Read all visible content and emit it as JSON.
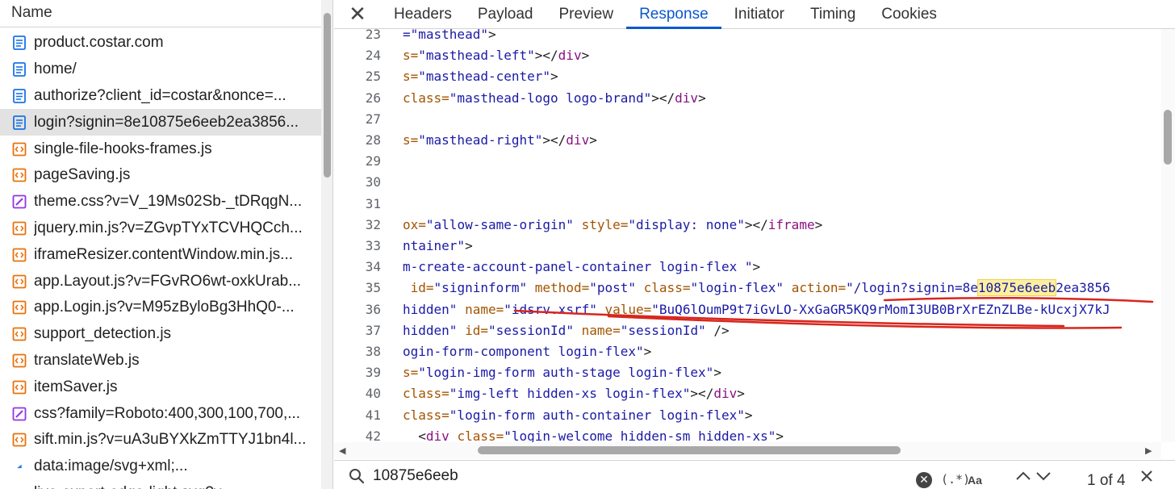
{
  "request_list": {
    "header": "Name",
    "items": [
      {
        "name": "product.costar.com",
        "icon": "document-icon"
      },
      {
        "name": "home/",
        "icon": "document-icon"
      },
      {
        "name": "authorize?client_id=costar&nonce=...",
        "icon": "document-icon"
      },
      {
        "name": "login?signin=8e10875e6eeb2ea3856...",
        "icon": "document-icon",
        "selected": true
      },
      {
        "name": "single-file-hooks-frames.js",
        "icon": "script-icon"
      },
      {
        "name": "pageSaving.js",
        "icon": "script-icon"
      },
      {
        "name": "theme.css?v=V_19Ms02Sb-_tDRqgN...",
        "icon": "stylesheet-icon"
      },
      {
        "name": "jquery.min.js?v=ZGvpTYxTCVHQCch...",
        "icon": "script-icon"
      },
      {
        "name": "iframeResizer.contentWindow.min.js...",
        "icon": "script-icon"
      },
      {
        "name": "app.Layout.js?v=FGvRO6wt-oxkUrab...",
        "icon": "script-icon"
      },
      {
        "name": "app.Login.js?v=M95zByloBg3HhQ0-...",
        "icon": "script-icon"
      },
      {
        "name": "support_detection.js",
        "icon": "script-icon"
      },
      {
        "name": "translateWeb.js",
        "icon": "script-icon"
      },
      {
        "name": "itemSaver.js",
        "icon": "script-icon"
      },
      {
        "name": "css?family=Roboto:400,300,100,700,...",
        "icon": "stylesheet-icon"
      },
      {
        "name": "sift.min.js?v=uA3uBYXkZmTTYJ1bn4l...",
        "icon": "script-icon"
      },
      {
        "name": "data:image/svg+xml;...",
        "icon": "image-icon"
      },
      {
        "name": "live-expert-edge-light.svg?v=...",
        "icon": "image-icon"
      }
    ]
  },
  "tabs": {
    "close": "✕",
    "items": [
      "Headers",
      "Payload",
      "Preview",
      "Response",
      "Initiator",
      "Timing",
      "Cookies"
    ],
    "active": "Response"
  },
  "response": {
    "lines": [
      {
        "n": "23",
        "parts": [
          [
            "val",
            "=\"masthead\""
          ],
          [
            "pun",
            ">"
          ]
        ]
      },
      {
        "n": "24",
        "parts": [
          [
            "att",
            "s="
          ],
          [
            "val",
            "\"masthead-left\""
          ],
          [
            "pun",
            "></"
          ],
          [
            "tag",
            "div"
          ],
          [
            "pun",
            ">"
          ]
        ]
      },
      {
        "n": "25",
        "parts": [
          [
            "att",
            "s="
          ],
          [
            "val",
            "\"masthead-center\""
          ],
          [
            "pun",
            ">"
          ]
        ]
      },
      {
        "n": "26",
        "parts": [
          [
            "att",
            "class="
          ],
          [
            "val",
            "\"masthead-logo logo-brand\""
          ],
          [
            "pun",
            "></"
          ],
          [
            "tag",
            "div"
          ],
          [
            "pun",
            ">"
          ]
        ]
      },
      {
        "n": "27",
        "parts": []
      },
      {
        "n": "28",
        "parts": [
          [
            "att",
            "s="
          ],
          [
            "val",
            "\"masthead-right\""
          ],
          [
            "pun",
            "></"
          ],
          [
            "tag",
            "div"
          ],
          [
            "pun",
            ">"
          ]
        ]
      },
      {
        "n": "29",
        "parts": []
      },
      {
        "n": "30",
        "parts": []
      },
      {
        "n": "31",
        "parts": []
      },
      {
        "n": "32",
        "parts": [
          [
            "att",
            "ox="
          ],
          [
            "val",
            "\"allow-same-origin\""
          ],
          [
            "pun",
            " "
          ],
          [
            "att",
            "style="
          ],
          [
            "val",
            "\"display: none\""
          ],
          [
            "pun",
            "></"
          ],
          [
            "tag",
            "iframe"
          ],
          [
            "pun",
            ">"
          ]
        ]
      },
      {
        "n": "33",
        "parts": [
          [
            "val",
            "ntainer\""
          ],
          [
            "pun",
            ">"
          ]
        ]
      },
      {
        "n": "34",
        "parts": [
          [
            "val",
            "m-create-account-panel-container login-flex \""
          ],
          [
            "pun",
            ">"
          ]
        ]
      },
      {
        "n": "35",
        "parts": [
          [
            "pun",
            " "
          ],
          [
            "att",
            "id="
          ],
          [
            "val",
            "\"signinform\""
          ],
          [
            "pun",
            " "
          ],
          [
            "att",
            "method="
          ],
          [
            "val",
            "\"post\""
          ],
          [
            "pun",
            " "
          ],
          [
            "att",
            "class="
          ],
          [
            "val",
            "\"login-flex\""
          ],
          [
            "pun",
            " "
          ],
          [
            "att",
            "action="
          ],
          [
            "val",
            "\"/login?signin=8e"
          ],
          [
            "hl",
            "10875e6eeb"
          ],
          [
            "val",
            "2ea3856"
          ]
        ]
      },
      {
        "n": "36",
        "parts": [
          [
            "val",
            "hidden\""
          ],
          [
            "pun",
            " "
          ],
          [
            "att",
            "name="
          ],
          [
            "val",
            "\"idsrv.xsrf\""
          ],
          [
            "pun",
            " "
          ],
          [
            "att",
            "value="
          ],
          [
            "val",
            "\"BuQ6lOumP9t7iGvLO-XxGaGR5KQ9rMomI3UB0BrXrEZnZLBe-kUcxjX7kJ"
          ]
        ]
      },
      {
        "n": "37",
        "parts": [
          [
            "val",
            "hidden\""
          ],
          [
            "pun",
            " "
          ],
          [
            "att",
            "id="
          ],
          [
            "val",
            "\"sessionId\""
          ],
          [
            "pun",
            " "
          ],
          [
            "att",
            "name="
          ],
          [
            "val",
            "\"sessionId\""
          ],
          [
            "pun",
            " />"
          ]
        ]
      },
      {
        "n": "38",
        "parts": [
          [
            "val",
            "ogin-form-component login-flex\""
          ],
          [
            "pun",
            ">"
          ]
        ]
      },
      {
        "n": "39",
        "parts": [
          [
            "att",
            "s="
          ],
          [
            "val",
            "\"login-img-form auth-stage login-flex\""
          ],
          [
            "pun",
            ">"
          ]
        ]
      },
      {
        "n": "40",
        "parts": [
          [
            "att",
            "class="
          ],
          [
            "val",
            "\"img-left hidden-xs login-flex\""
          ],
          [
            "pun",
            "></"
          ],
          [
            "tag",
            "div"
          ],
          [
            "pun",
            ">"
          ]
        ]
      },
      {
        "n": "41",
        "parts": [
          [
            "att",
            "class="
          ],
          [
            "val",
            "\"login-form auth-container login-flex\""
          ],
          [
            "pun",
            ">"
          ]
        ]
      },
      {
        "n": "42",
        "parts": [
          [
            "pun",
            "  <"
          ],
          [
            "tag",
            "div"
          ],
          [
            "pun",
            " "
          ],
          [
            "att",
            "class="
          ],
          [
            "val",
            "\"login-welcome hidden-sm hidden-xs\""
          ],
          [
            "pun",
            ">"
          ]
        ]
      }
    ]
  },
  "search": {
    "value": "10875e6eeb",
    "regex_label": "(.*)",
    "case_label": "Aa",
    "match_count": "1 of 4"
  },
  "colors": {
    "accent": "#0b57d0",
    "annotation": "#d7261e",
    "highlight": "#fcf0a0"
  }
}
